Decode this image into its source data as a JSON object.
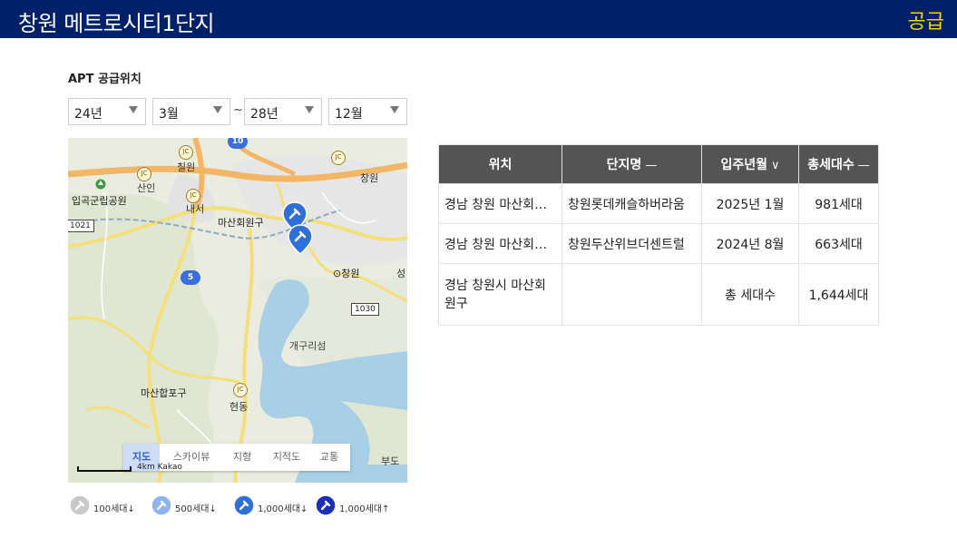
{
  "header": {
    "title": "창원 메트로시티1단지",
    "badge": "공급"
  },
  "filter": {
    "section_label": "APT 공급위치",
    "start_year": "24년",
    "start_month": "3월",
    "separator": "~",
    "end_year": "28년",
    "end_month": "12월"
  },
  "map": {
    "labels": {
      "chilwon": "칠원",
      "sanin": "산인",
      "park": "입곡군립공원",
      "naeseo": "내서",
      "masanhoewon": "마산회원구",
      "changwon_top": "창원",
      "changwon_station": "⊙창원",
      "seong": "성",
      "gaegurisum": "개구리섬",
      "masanhappo": "마산합포구",
      "hyeondong": "현동",
      "budo": "부도"
    },
    "routes": {
      "r10": "10",
      "r5": "5",
      "r1021": "1021",
      "r1030": "1030",
      "jc": "JC"
    },
    "map_types": {
      "map": "지도",
      "skyview": "스카이뷰",
      "terrain": "지형",
      "cadastral": "지적도",
      "traffic": "교통"
    },
    "scale_text": "4km Kakao",
    "colors": {
      "water": "#a9cfe6",
      "highway": "#f2b666",
      "road": "#f4df7a",
      "pin_blue": "#2f6fd8"
    }
  },
  "legend": [
    {
      "icon": "pin-gray-icon",
      "label": "100세대↓"
    },
    {
      "icon": "pin-lightblue-icon",
      "label": "500세대↓"
    },
    {
      "icon": "pin-blue-icon",
      "label": "1,000세대↓"
    },
    {
      "icon": "pin-darkblue-icon",
      "label": "1,000세대↑"
    }
  ],
  "table": {
    "headers": {
      "location": "위치",
      "complex": "단지명",
      "complex_sort": "—",
      "move_in": "입주년월",
      "move_in_sort": "∨",
      "households": "총세대수",
      "households_sort": "—"
    },
    "rows": [
      {
        "location": "경남 창원 마산회원구",
        "complex": "창원롯데캐슬하버라움",
        "move_in": "2025년 1월",
        "households": "981세대"
      },
      {
        "location": "경남 창원 마산회원구",
        "complex": "창원두산위브더센트럴",
        "move_in": "2024년 8월",
        "households": "663세대"
      }
    ],
    "total": {
      "location": "경남 창원시 마산회원구",
      "label": "총 세대수",
      "households": "1,644세대"
    }
  }
}
